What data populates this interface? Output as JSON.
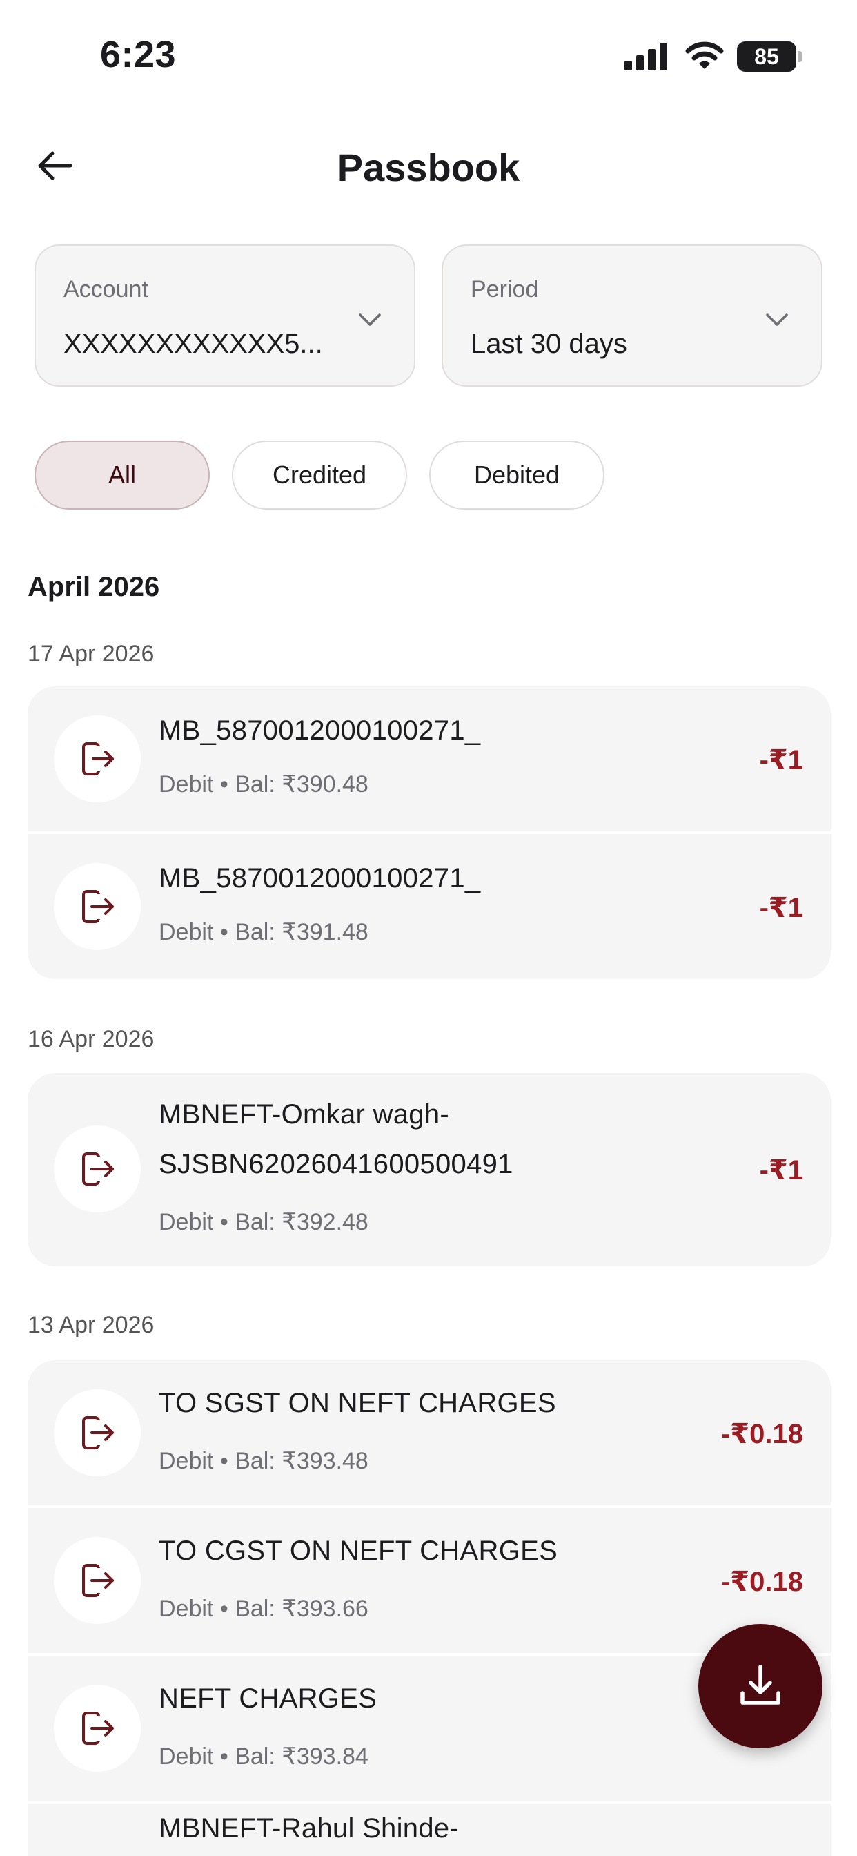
{
  "status_bar": {
    "time": "6:23",
    "battery": "85"
  },
  "header": {
    "title": "Passbook"
  },
  "account": {
    "label": "Account",
    "value": "XXXXXXXXXXXX5..."
  },
  "period": {
    "label": "Period",
    "value": "Last 30 days"
  },
  "filters": {
    "all": "All",
    "credited": "Credited",
    "debited": "Debited",
    "selected": "All"
  },
  "month": "April 2026",
  "dates": [
    "17 Apr 2026",
    "16 Apr 2026",
    "13 Apr 2026"
  ],
  "transactions": [
    {
      "title": "MB_5870012000100271_",
      "title2": "",
      "type": "Debit",
      "sep": "•",
      "balance": "Bal: ₹390.48",
      "amount": "-₹1"
    },
    {
      "title": "MB_5870012000100271_",
      "title2": "",
      "type": "Debit",
      "sep": "•",
      "balance": "Bal: ₹391.48",
      "amount": "-₹1"
    },
    {
      "title": "MBNEFT-Omkar wagh-",
      "title2": "SJSBN62026041600500491",
      "type": "Debit",
      "sep": "•",
      "balance": "Bal: ₹392.48",
      "amount": "-₹1"
    },
    {
      "title": "TO SGST ON NEFT CHARGES",
      "title2": "",
      "type": "Debit",
      "sep": "•",
      "balance": "Bal: ₹393.48",
      "amount": "-₹0.18"
    },
    {
      "title": "TO CGST ON NEFT CHARGES",
      "title2": "",
      "type": "Debit",
      "sep": "•",
      "balance": "Bal: ₹393.66",
      "amount": "-₹0.18"
    },
    {
      "title": "NEFT CHARGES",
      "title2": "",
      "type": "Debit",
      "sep": "•",
      "balance": "Bal: ₹393.84",
      "amount": ""
    },
    {
      "title": "MBNEFT-Rahul Shinde-",
      "title2": "",
      "type": "",
      "sep": "",
      "balance": "",
      "amount": ""
    }
  ],
  "icons": {
    "back": "arrow-left-icon",
    "chevron": "chevron-down-icon",
    "txn": "debit-exit-icon",
    "download": "download-icon"
  },
  "colors": {
    "accent": "#4a0a0f",
    "amount": "#9b1c22",
    "chip_active_bg": "#efe5e6"
  }
}
